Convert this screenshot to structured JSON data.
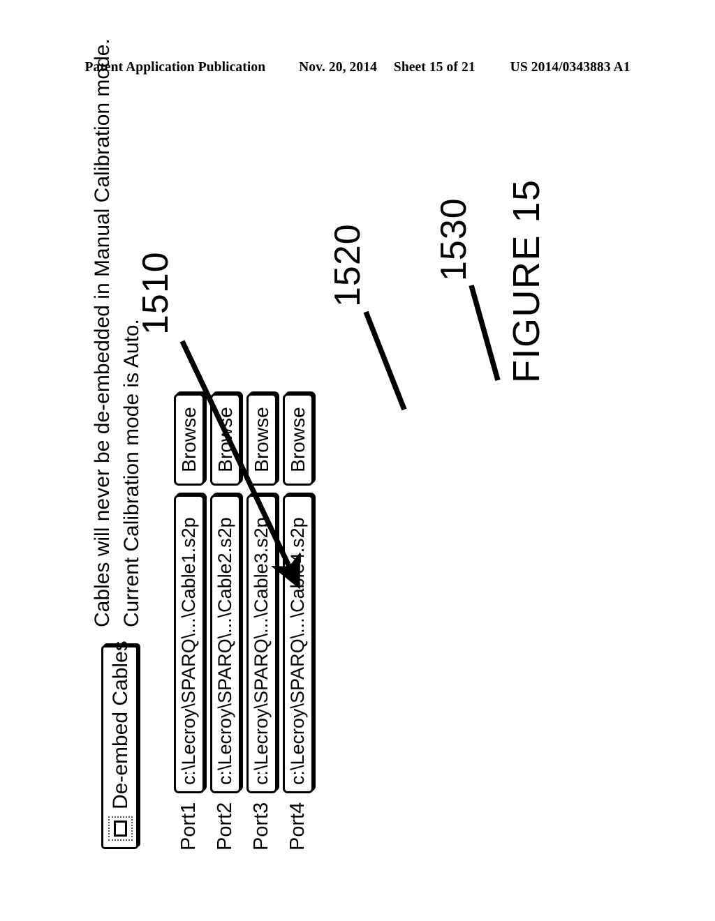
{
  "header": {
    "publication": "Patent Application Publication",
    "date": "Nov. 20, 2014",
    "sheet": "Sheet 15 of 21",
    "patent_number": "US 2014/0343883 A1"
  },
  "dialog": {
    "checkbox": {
      "label": "De-embed Cables",
      "checked": false
    },
    "notes": [
      "Cables will never be de-embedded in Manual Calibration mode.",
      "Current Calibration mode is Auto."
    ],
    "ports": [
      {
        "label": "Port1",
        "path": "c:\\Lecroy\\SPARQ\\...\\Cable1.s2p",
        "browse_label": "Browse"
      },
      {
        "label": "Port2",
        "path": "c:\\Lecroy\\SPARQ\\...\\Cable2.s2p",
        "browse_label": "Browse"
      },
      {
        "label": "Port3",
        "path": "c:\\Lecroy\\SPARQ\\...\\Cable3.s2p",
        "browse_label": "Browse"
      },
      {
        "label": "Port4",
        "path": "c:\\Lecroy\\SPARQ\\...\\Cable4.s2p",
        "browse_label": "Browse"
      }
    ]
  },
  "callouts": {
    "note_ref": "1510",
    "path_field_ref": "1520",
    "port_label_ref": "1530"
  },
  "figure": {
    "caption": "FIGURE 15"
  },
  "colors": {
    "ink": "#000000",
    "paper": "#ffffff"
  }
}
